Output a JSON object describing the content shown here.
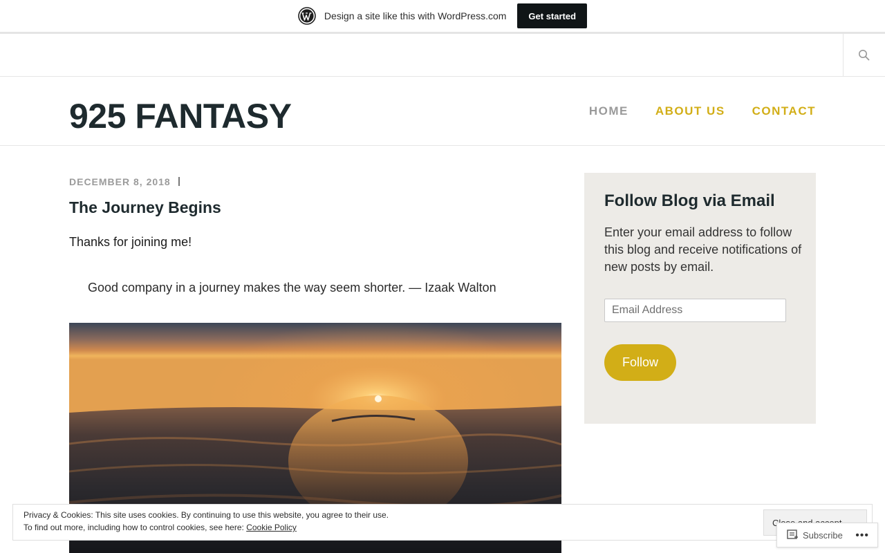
{
  "banner": {
    "text": "Design a site like this with WordPress.com",
    "cta": "Get started",
    "logo_icon": "wordpress-logo-icon"
  },
  "search": {
    "icon": "search-icon"
  },
  "header": {
    "site_title": "925 FANTASY",
    "nav": [
      {
        "label": "HOME",
        "color": "#9a9a9a"
      },
      {
        "label": "ABOUT US",
        "color": "#d2ae17"
      },
      {
        "label": "CONTACT",
        "color": "#d2ae17"
      }
    ]
  },
  "post": {
    "date": "DECEMBER 8, 2018",
    "title": "The Journey Begins",
    "intro": "Thanks for joining me!",
    "quote": "Good company in a journey makes the way seem shorter. — Izaak Walton"
  },
  "widget": {
    "title": "Follow Blog via Email",
    "description": "Enter your email address to follow this blog and receive notifications of new posts by email.",
    "email_placeholder": "Email Address",
    "follow_label": "Follow"
  },
  "cookie": {
    "line1": "Privacy & Cookies: This site uses cookies. By continuing to use this website, you agree to their use.",
    "line2_prefix": "To find out more, including how to control cookies, see here: ",
    "policy_link": "Cookie Policy",
    "close_label": "Close and accept"
  },
  "subscribe": {
    "label": "Subscribe",
    "more": "•••"
  },
  "colors": {
    "accent": "#d2ae17",
    "title": "#1e2a2e",
    "widget_bg": "#edebe7"
  }
}
